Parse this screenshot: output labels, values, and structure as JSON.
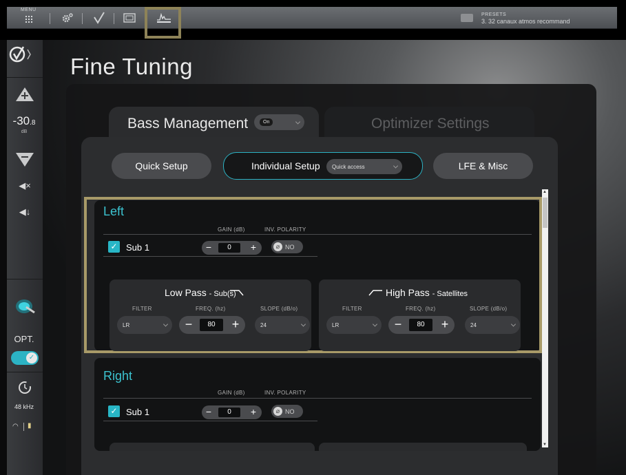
{
  "toolbar": {
    "menu_label": "MENU",
    "icons": [
      "menu-icon",
      "settings-icon",
      "check-icon",
      "layout-icon",
      "tuning-icon"
    ],
    "presets_label": "PRESETS",
    "presets_value": "3. 32 canaux atmos recommand"
  },
  "sidebar": {
    "volume_value": "-30",
    "volume_decimal": ".8",
    "volume_unit": "dB",
    "opt_label": "OPT.",
    "sample_rate": "48 kHz"
  },
  "page": {
    "title": "Fine Tuning"
  },
  "tabs": {
    "bass_management": "Bass Management",
    "bass_state": "On",
    "optimizer": "Optimizer Settings"
  },
  "subtabs": {
    "quick_setup": "Quick Setup",
    "individual_setup": "Individual Setup",
    "quick_access": "Quick access",
    "lfe_misc": "LFE & Misc"
  },
  "headers": {
    "gain": "GAIN (dB)",
    "inv_polarity": "INV. POLARITY",
    "filter": "FILTER",
    "freq": "FREQ. (hz)",
    "slope": "SLOPE (dB/o)"
  },
  "channels": [
    {
      "name": "Left",
      "sub_label": "Sub 1",
      "gain": "0",
      "polarity": "NO",
      "low_pass": {
        "title": "Low Pass",
        "suffix": "- Sub(s)",
        "filter": "LR",
        "freq": "80",
        "slope": "24"
      },
      "high_pass": {
        "title": "High Pass",
        "suffix": "- Satellites",
        "filter": "LR",
        "freq": "80",
        "slope": "24"
      }
    },
    {
      "name": "Right",
      "sub_label": "Sub 1",
      "gain": "0",
      "polarity": "NO"
    }
  ],
  "colors": {
    "accent": "#2cb3c4",
    "highlight": "#a89a68"
  }
}
